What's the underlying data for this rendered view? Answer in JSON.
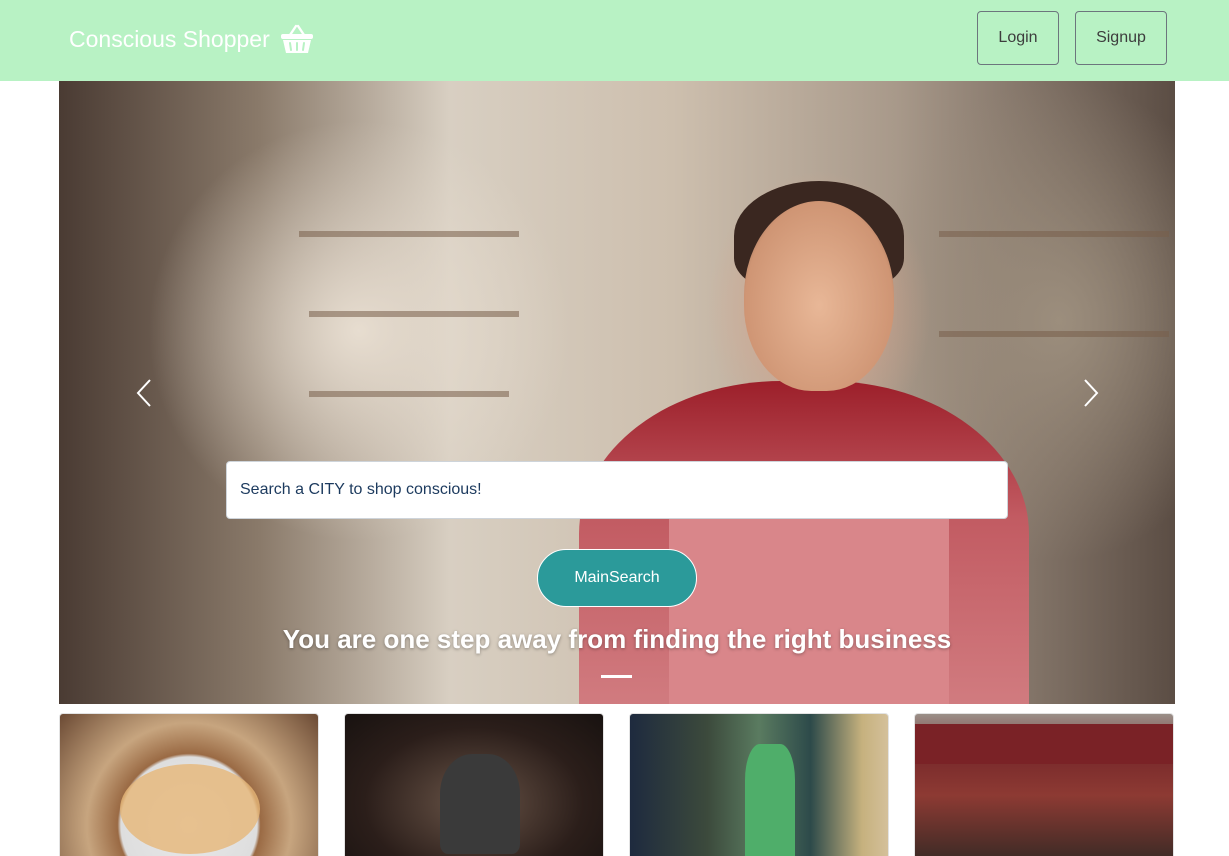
{
  "navbar": {
    "brand": "Conscious Shopper",
    "brand_icon": "shopping-basket-icon",
    "login_label": "Login",
    "signup_label": "Signup",
    "background_color": "#b8f2c4"
  },
  "hero": {
    "search_placeholder": "Search a CITY to shop conscious!",
    "search_button_label": "MainSearch",
    "caption": "You are one step away from finding the right business",
    "prev_icon": "chevron-left-icon",
    "next_icon": "chevron-right-icon",
    "button_color": "#2b9a9a"
  },
  "cards": [
    {
      "image": "cookie-tin-photo"
    },
    {
      "image": "bartender-photo"
    },
    {
      "image": "storefront-couple-photo"
    },
    {
      "image": "amy-ruths-restaurant-photo"
    }
  ]
}
